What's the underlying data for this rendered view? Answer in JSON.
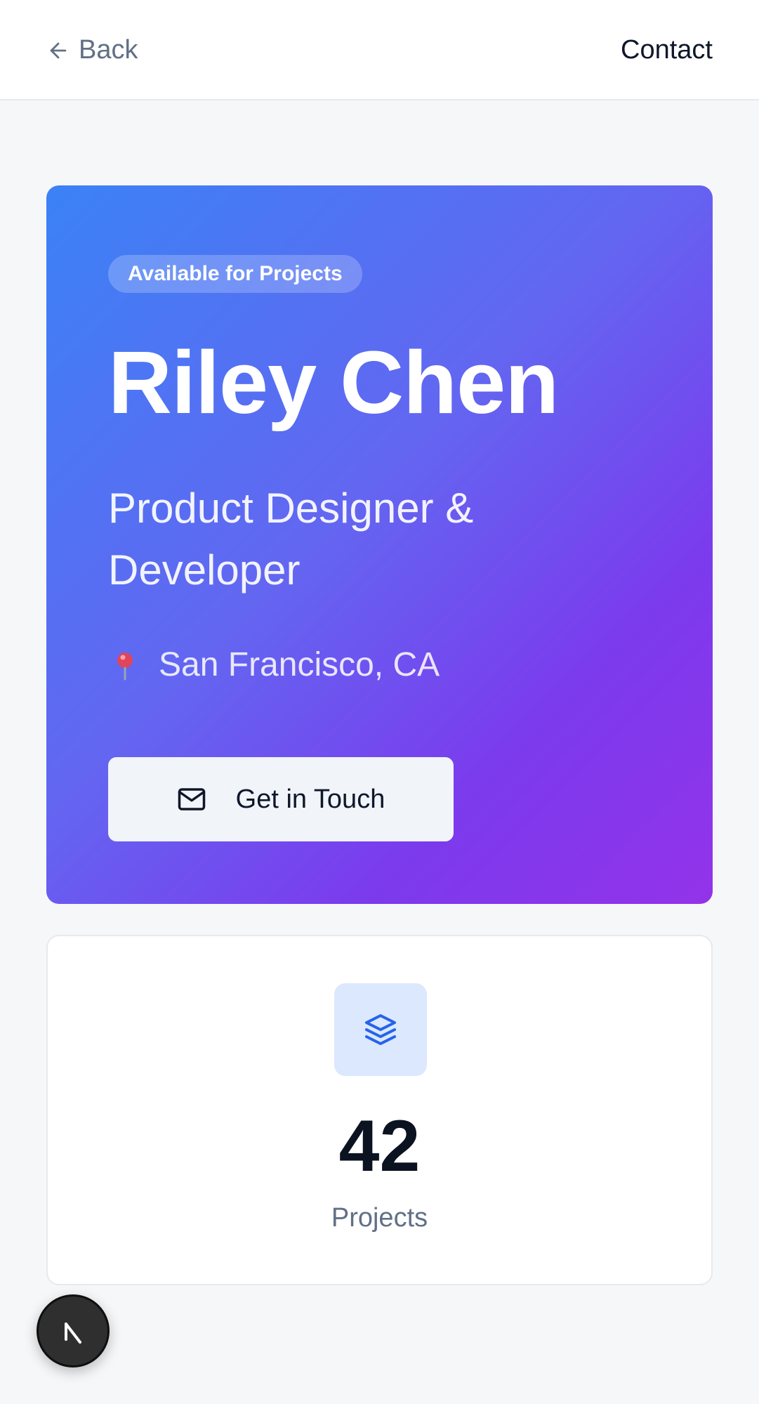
{
  "topbar": {
    "back_label": "Back",
    "contact_label": "Contact"
  },
  "hero": {
    "badge": "Available for Projects",
    "name": "Riley Chen",
    "role": "Product Designer & Developer",
    "location": "San Francisco, CA",
    "cta_label": "Get in Touch",
    "gradient_colors": [
      "#3b82f6",
      "#6366f1",
      "#7c3aed",
      "#9333ea"
    ]
  },
  "stats": {
    "projects_value": "42",
    "projects_label": "Projects",
    "icon": "layers-icon",
    "accent": "#2563eb"
  },
  "fab": {
    "label": "N",
    "icon": "nextjs-icon"
  }
}
